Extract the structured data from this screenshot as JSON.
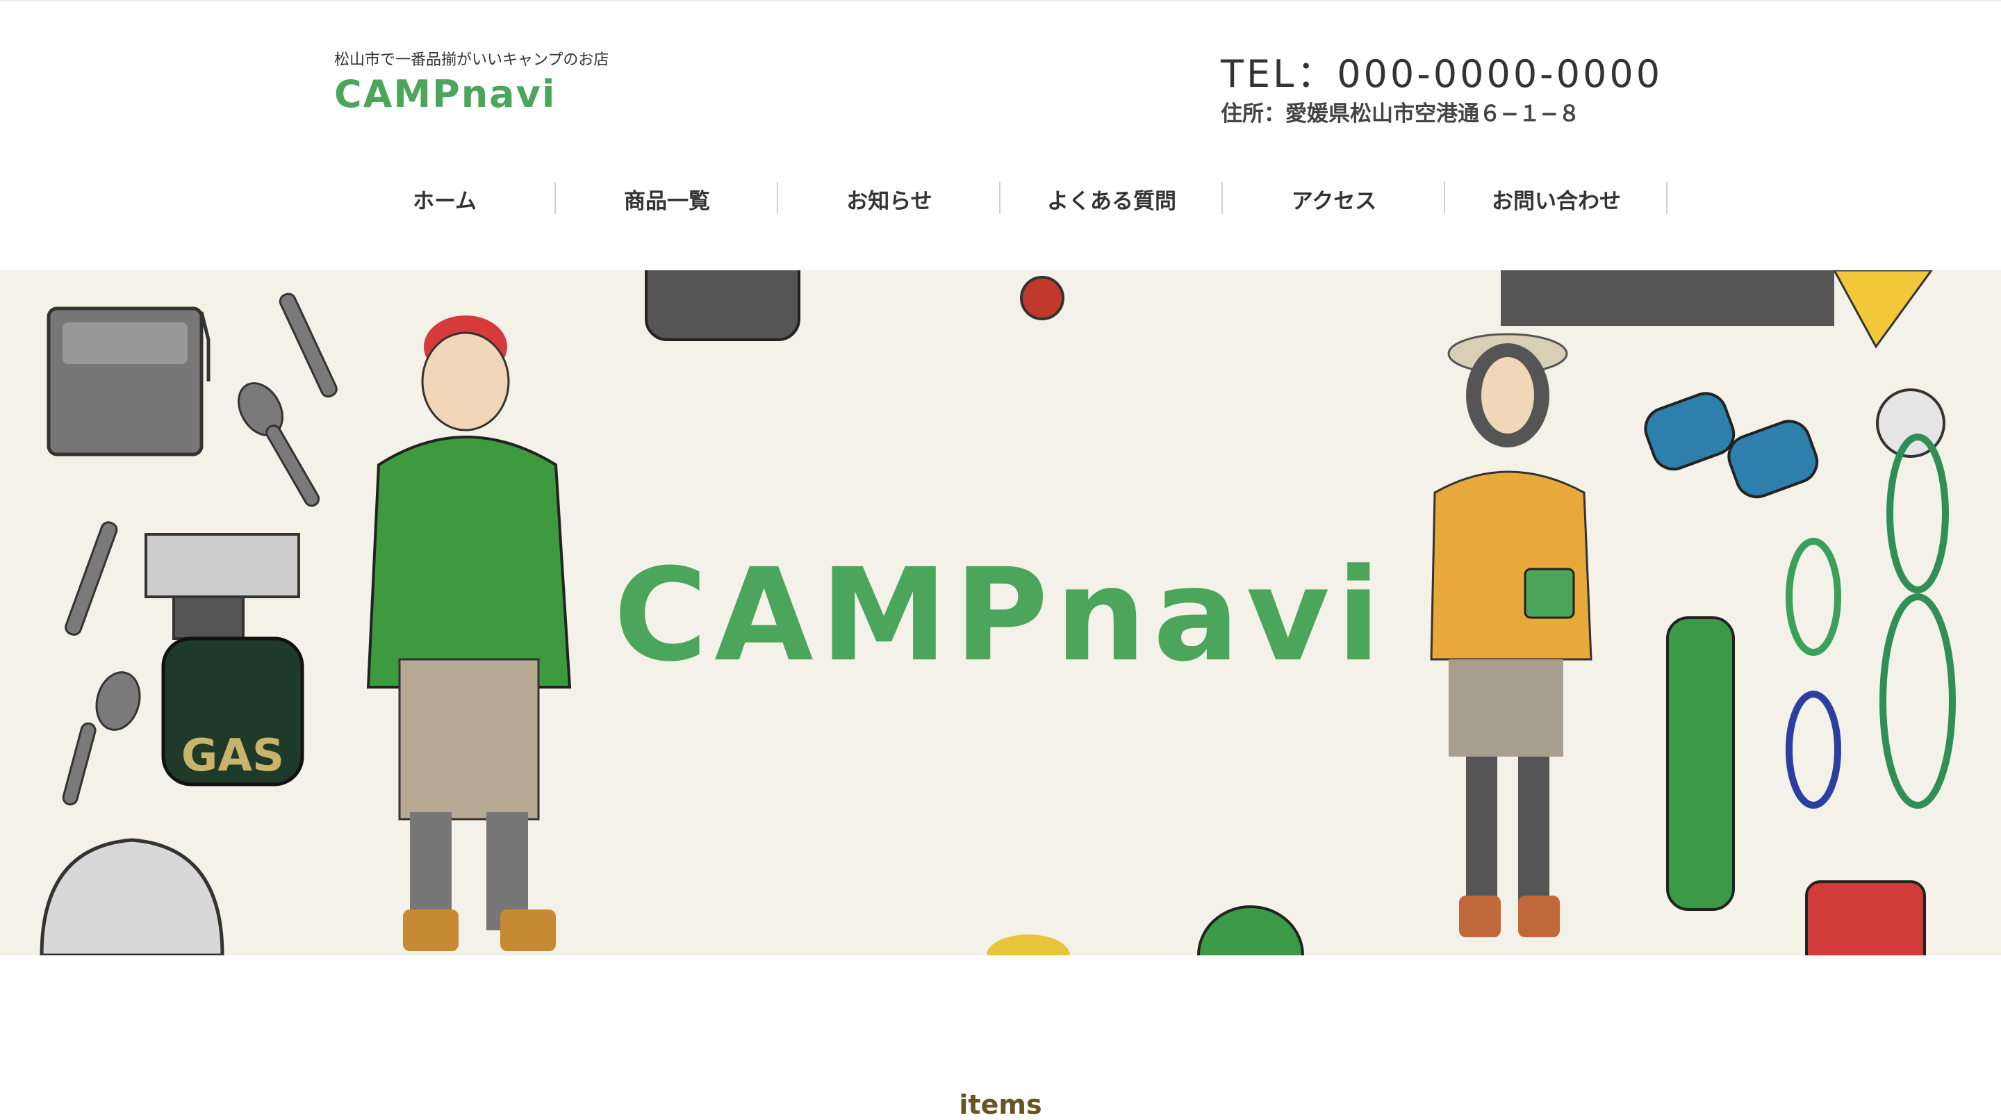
{
  "header": {
    "tagline": "松山市で一番品揃がいいキャンプのお店",
    "logo": "CAMPnavi",
    "tel": "TEL：000-0000-0000",
    "address": "住所：愛媛県松山市空港通６−１−８"
  },
  "nav": {
    "items": [
      {
        "label": "ホーム"
      },
      {
        "label": "商品一覧"
      },
      {
        "label": "お知らせ"
      },
      {
        "label": "よくある質問"
      },
      {
        "label": "アクセス"
      },
      {
        "label": "お問い合わせ"
      }
    ]
  },
  "hero": {
    "logo": "CAMPnavi",
    "gas_label": "GAS"
  },
  "section": {
    "title": "items"
  },
  "colors": {
    "brand_green": "#4ba55a",
    "hero_bg": "#f3f1e8",
    "section_title": "#6a5222"
  }
}
